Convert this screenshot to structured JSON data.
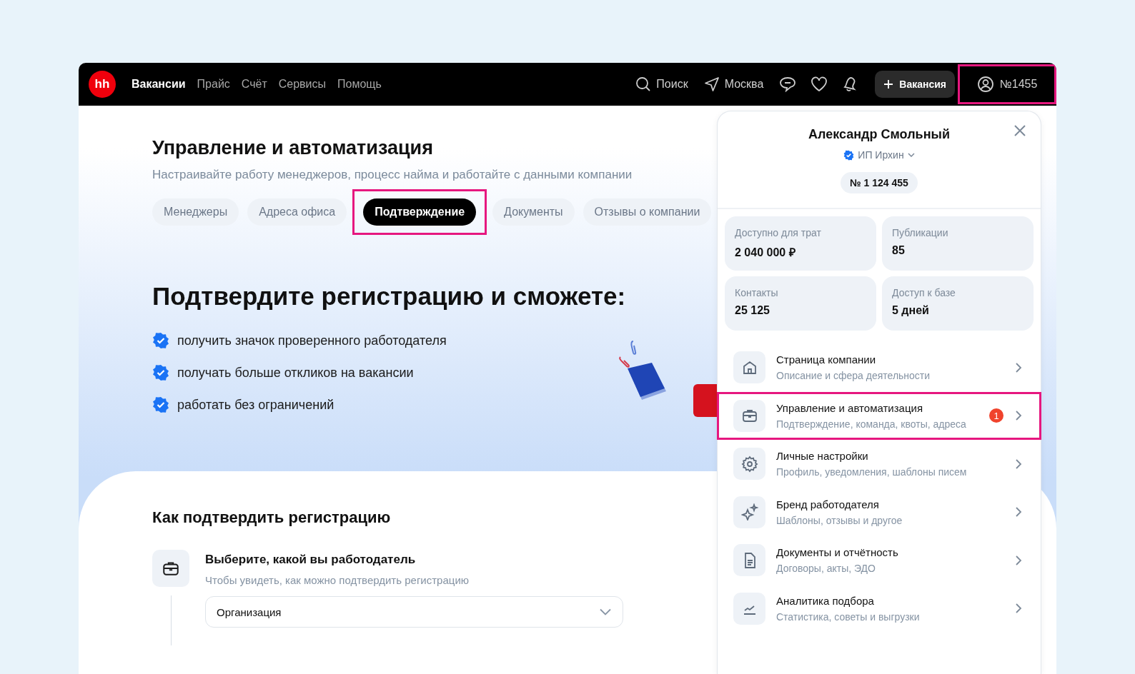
{
  "nav": {
    "logo": "hh",
    "links": [
      {
        "label": "Вакансии",
        "selected": true
      },
      {
        "label": "Прайс",
        "selected": false
      },
      {
        "label": "Счёт",
        "selected": false
      },
      {
        "label": "Сервисы",
        "selected": false
      },
      {
        "label": "Помощь",
        "selected": false
      }
    ],
    "search": "Поиск",
    "city": "Москва",
    "create_button": "Вакансия",
    "account": {
      "label": "№1455",
      "highlighted": true
    }
  },
  "page": {
    "title": "Управление и автоматизация",
    "subtitle": "Настраивайте работу менеджеров, процесс найма и работайте с данными компании",
    "tabs": [
      {
        "label": "Менеджеры",
        "selected": false,
        "highlighted": false
      },
      {
        "label": "Адреса офиса",
        "selected": false,
        "highlighted": false
      },
      {
        "label": "Подтверждение",
        "selected": true,
        "highlighted": true
      },
      {
        "label": "Документы",
        "selected": false,
        "highlighted": false
      },
      {
        "label": "Отзывы о компании",
        "selected": false,
        "highlighted": false
      }
    ]
  },
  "hero": {
    "title": "Подтвердите регистрацию и сможете:",
    "benefits": [
      "получить значок проверенного работодателя",
      "получать больше откликов на вакансии",
      "работать без ограничений"
    ]
  },
  "how_to": {
    "title": "Как подтвердить регистрацию",
    "step": {
      "title": "Выберите, какой вы работодатель",
      "hint": "Чтобы увидеть, как можно подтвердить регистрацию",
      "select_value": "Организация"
    }
  },
  "profile_popup": {
    "name": "Александр Смольный",
    "company": "ИП Ирхин",
    "company_verified": true,
    "number": "№ 1 124 455",
    "stats": [
      {
        "label": "Доступно для трат",
        "value": "2 040 000 ₽"
      },
      {
        "label": "Публикации",
        "value": "85"
      },
      {
        "label": "Контакты",
        "value": "25 125"
      },
      {
        "label": "Доступ к базе",
        "value": "5 дней"
      }
    ],
    "menu": [
      {
        "title": "Страница компании",
        "subtitle": "Описание и сфера деятельности",
        "highlighted": false
      },
      {
        "title": "Управление и автоматизация",
        "subtitle": "Подтверждение, команда, квоты, адреса",
        "badge": "1",
        "highlighted": true
      },
      {
        "title": "Личные настройки",
        "subtitle": "Профиль, уведомления, шаблоны писем",
        "highlighted": false
      },
      {
        "title": "Бренд работодателя",
        "subtitle": "Шаблоны, отзывы и другое",
        "highlighted": false
      },
      {
        "title": "Документы и отчётность",
        "subtitle": "Договоры, акты, ЭДО",
        "highlighted": false
      },
      {
        "title": "Аналитика подбора",
        "subtitle": "Статистика, советы и выгрузки",
        "highlighted": false
      }
    ]
  }
}
